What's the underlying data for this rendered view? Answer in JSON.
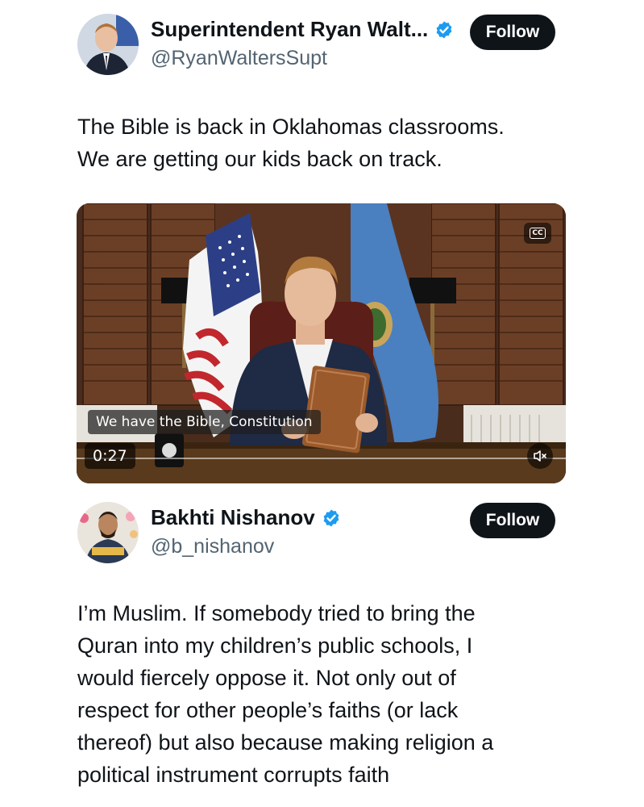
{
  "tweets": [
    {
      "author_name": "Superintendent Ryan Walt...",
      "handle": "@RyanWaltersSupt",
      "follow_label": "Follow",
      "text_lines": [
        "The Bible is back in Oklahomas classrooms.",
        "We are getting our kids back on track."
      ],
      "video": {
        "subtitle": "We have the Bible, Constitution",
        "duration": "0:27",
        "cc_label": "CC"
      }
    },
    {
      "author_name": "Bakhti Nishanov",
      "handle": "@b_nishanov",
      "follow_label": "Follow",
      "text_lines": [
        "I’m Muslim. If somebody tried to bring the",
        "Quran into my children’s public schools, I",
        "would fiercely oppose it. Not only out of",
        "respect for other people’s faiths (or lack",
        "thereof) but also because making religion a",
        "political instrument corrupts faith"
      ]
    }
  ],
  "colors": {
    "text": "#0f1419",
    "secondary": "#536471",
    "verified": "#1d9bf0",
    "follow_bg": "#0f1419"
  },
  "icons": [
    "verified-badge-icon",
    "closed-captions-icon",
    "muted-speaker-icon"
  ]
}
